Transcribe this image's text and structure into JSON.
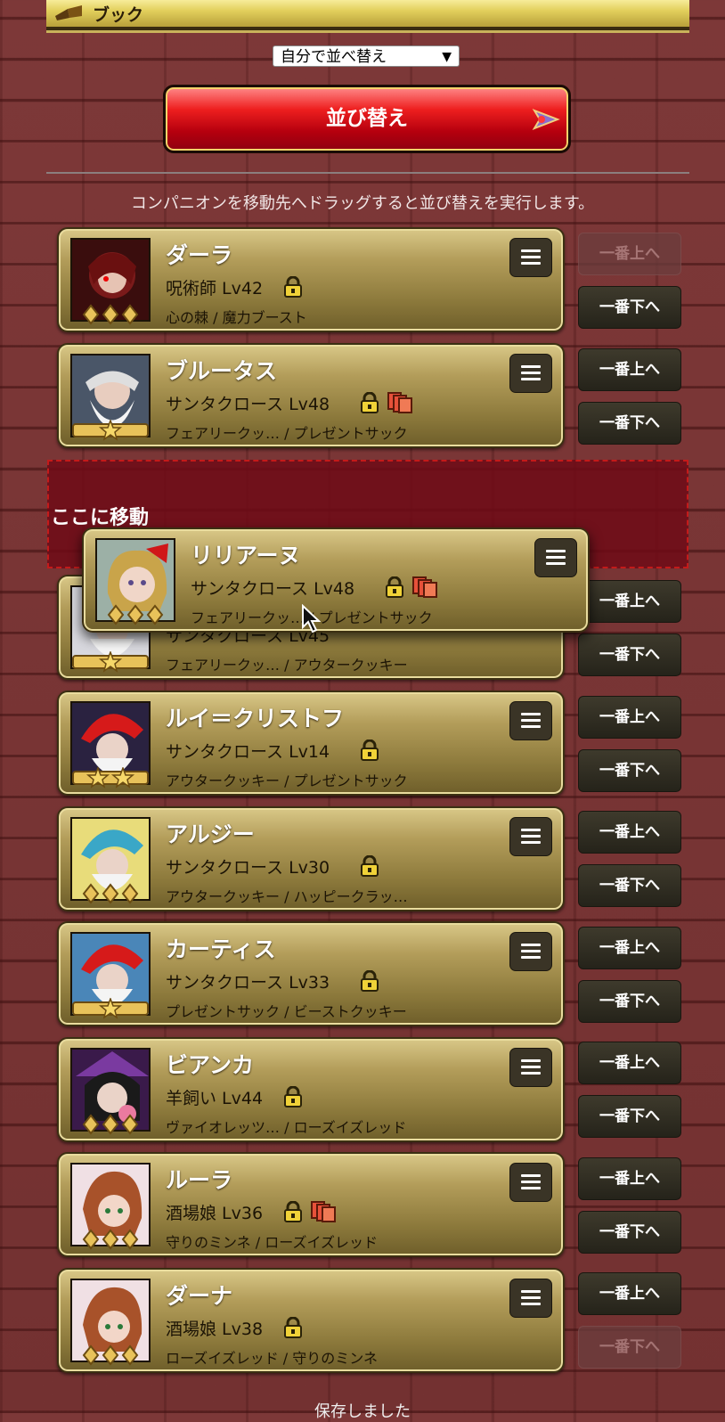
{
  "header": {
    "title": "ブック",
    "icon": "book-icon"
  },
  "sort": {
    "select_value": "自分で並べ替え",
    "button_label": "並び替え",
    "hint": "コンパニオンを移動先へドラッグすると並び替えを実行します。"
  },
  "labels": {
    "top": "一番上へ",
    "bottom": "一番下へ",
    "dropzone": "ここに移動"
  },
  "dragging": {
    "name": "リリアーヌ",
    "class": "サンタクロース Lv48",
    "skills": "フェアリークッ… / プレゼントサック"
  },
  "companions": [
    {
      "name": "ダーラ",
      "class": "呪術師 Lv42",
      "skills": "心の棘 / 魔力ブースト"
    },
    {
      "name": "ブルータス",
      "class": "サンタクロース Lv48",
      "skills": "フェアリークッ… / プレゼントサック"
    },
    {
      "name": "",
      "class": "サンタクロース Lv45",
      "skills": "フェアリークッ… / アウタークッキー"
    },
    {
      "name": "ルイ＝クリストフ",
      "class": "サンタクロース Lv14",
      "skills": "アウタークッキー / プレゼントサック"
    },
    {
      "name": "アルジー",
      "class": "サンタクロース Lv30",
      "skills": "アウタークッキー / ハッピークラッ…"
    },
    {
      "name": "カーティス",
      "class": "サンタクロース Lv33",
      "skills": "プレゼントサック / ビーストクッキー"
    },
    {
      "name": "ビアンカ",
      "class": "羊飼い Lv44",
      "skills": "ヴァイオレッツ… / ローズイズレッド"
    },
    {
      "name": "ルーラ",
      "class": "酒場娘 Lv36",
      "skills": "守りのミンネ / ローズイズレッド"
    },
    {
      "name": "ダーナ",
      "class": "酒場娘 Lv38",
      "skills": "ローズイズレッド / 守りのミンネ"
    }
  ],
  "footer": {
    "saved": "保存しました"
  },
  "colors": {
    "background": "#7a3535",
    "card_gold": "#b39d5a",
    "button_red": "#e01515",
    "dropzone": "#6e0a16"
  }
}
